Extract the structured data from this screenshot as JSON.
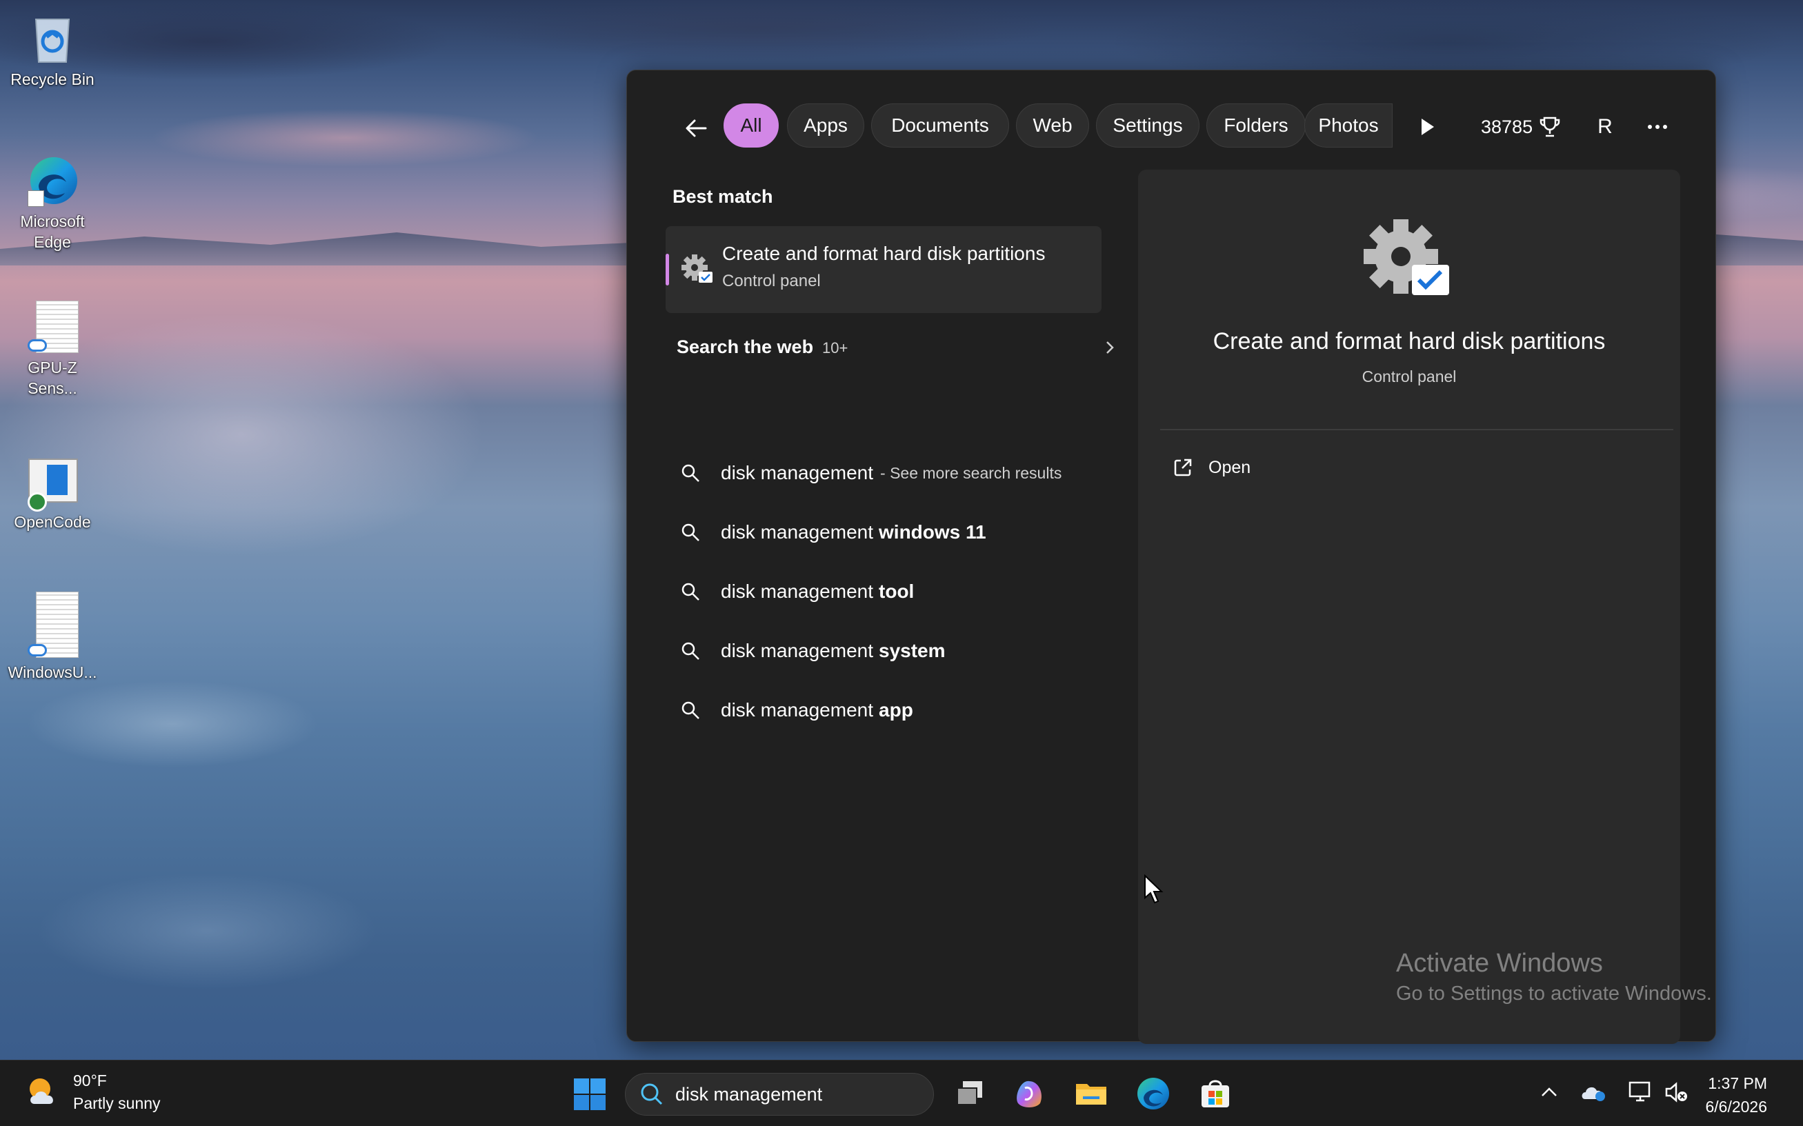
{
  "desktop": {
    "icons": [
      {
        "label": "Recycle Bin"
      },
      {
        "label": "Microsoft Edge"
      },
      {
        "label": "GPU-Z Sens..."
      },
      {
        "label": "OpenCode"
      },
      {
        "label": "WindowsU..."
      }
    ]
  },
  "search_panel": {
    "filters": [
      "All",
      "Apps",
      "Documents",
      "Web",
      "Settings",
      "Folders",
      "Photos"
    ],
    "active_filter": "All",
    "points": "38785",
    "avatar_initial": "R",
    "best_match": {
      "section_title": "Best match",
      "title": "Create and format hard disk partitions",
      "subtitle": "Control panel"
    },
    "web": {
      "section_title": "Search the web",
      "count": "10+",
      "suggestions": [
        {
          "base": "disk management",
          "bold": "",
          "more": "- See more search results"
        },
        {
          "base": "disk management",
          "bold": "windows 11",
          "more": ""
        },
        {
          "base": "disk management",
          "bold": "tool",
          "more": ""
        },
        {
          "base": "disk management",
          "bold": "system",
          "more": ""
        },
        {
          "base": "disk management",
          "bold": "app",
          "more": ""
        }
      ]
    },
    "preview": {
      "title": "Create and format hard disk partitions",
      "subtitle": "Control panel",
      "action_open": "Open"
    }
  },
  "watermark": {
    "line1": "Activate Windows",
    "line2": "Go to Settings to activate Windows."
  },
  "taskbar": {
    "weather_temp": "90°F",
    "weather_condition": "Partly sunny",
    "search_value": "disk management",
    "time": "1:37 PM",
    "date": "6/6/2026"
  },
  "colors": {
    "accent": "#d287e6",
    "panel_bg": "#202020",
    "preview_bg": "#2a2a2a"
  }
}
